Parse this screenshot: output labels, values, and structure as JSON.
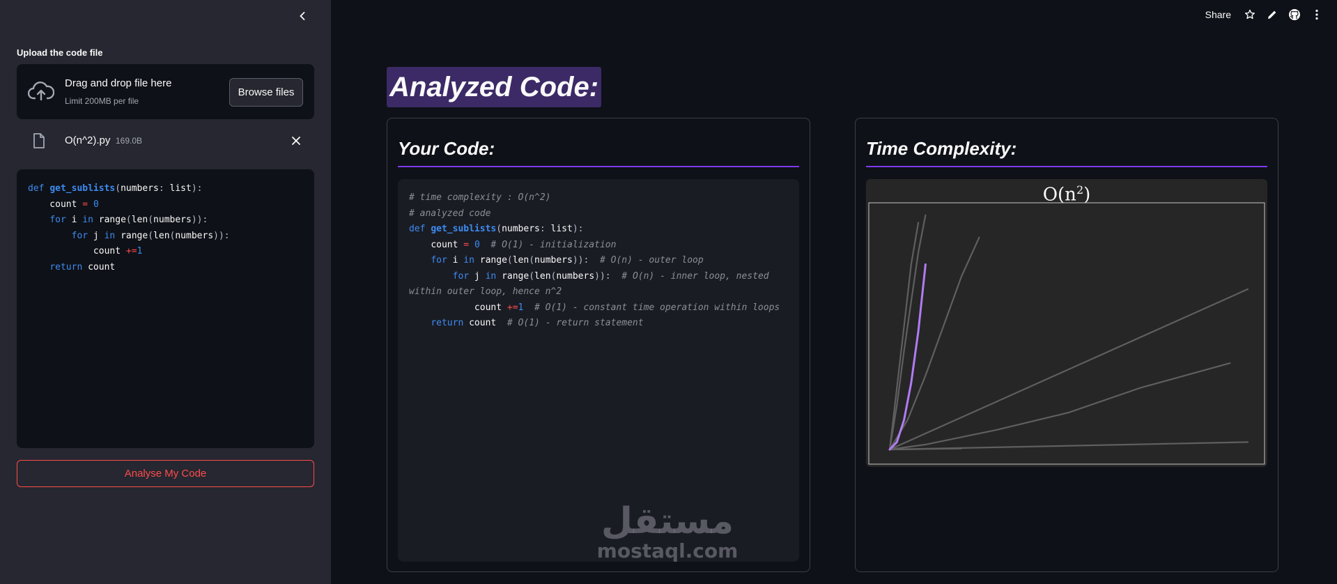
{
  "sidebar": {
    "upload_label": "Upload the code file",
    "dropzone": {
      "title": "Drag and drop file here",
      "limit": "Limit 200MB per file",
      "browse_label": "Browse files"
    },
    "file": {
      "name": "O(n^2).py",
      "size": "169.0B"
    },
    "analyse_label": "Analyse My Code"
  },
  "header": {
    "share_label": "Share"
  },
  "main": {
    "title": "Analyzed Code:",
    "code_panel": {
      "heading": "Your Code:"
    },
    "tc_panel": {
      "heading": "Time Complexity:"
    }
  },
  "watermark": {
    "arabic": "مستقل",
    "latin": "mostaql.com"
  },
  "colors": {
    "accent": "#7c3aed",
    "primary_red": "#ff4b4b",
    "keyword_blue": "#3d8bf2",
    "highlight_curve": "#b07cf2"
  },
  "chart_data": {
    "type": "line",
    "title_base": "O(n",
    "title_sup": "2",
    "title_end": ")",
    "highlighted": "O(n^2)",
    "series": [
      {
        "values_x": [
          0.0,
          0.05,
          0.1,
          0.15,
          0.2
        ],
        "values_y": [
          0.0,
          0.0005,
          0.002,
          0.003,
          0.004
        ],
        "highlight": false
      },
      {
        "values_x": [
          0.0,
          0.1,
          0.2,
          0.3,
          0.5,
          0.7,
          0.95
        ],
        "values_y": [
          0.0,
          0.02,
          0.05,
          0.08,
          0.15,
          0.25,
          0.35
        ],
        "highlight": false
      },
      {
        "values_x": [
          0.0,
          1.0
        ],
        "values_y": [
          0.0,
          0.03
        ],
        "highlight": false
      },
      {
        "values_x": [
          0.0,
          1.0
        ],
        "values_y": [
          0.0,
          0.65
        ],
        "highlight": false
      },
      {
        "values_x": [
          0.0,
          0.05,
          0.1,
          0.15,
          0.2,
          0.25
        ],
        "values_y": [
          0.0,
          0.12,
          0.3,
          0.5,
          0.7,
          0.86
        ],
        "highlight": false
      },
      {
        "values_x": [
          0.0,
          0.02,
          0.04,
          0.06,
          0.08,
          0.1
        ],
        "values_y": [
          0.0,
          0.18,
          0.4,
          0.6,
          0.8,
          0.95
        ],
        "highlight": false
      },
      {
        "values_x": [
          0.0,
          0.02,
          0.04,
          0.06,
          0.08
        ],
        "values_y": [
          0.0,
          0.25,
          0.5,
          0.75,
          0.92
        ],
        "highlight": false
      },
      {
        "values_x": [
          0.0,
          0.02,
          0.04,
          0.06,
          0.08,
          0.1
        ],
        "values_y": [
          0.0,
          0.03,
          0.12,
          0.27,
          0.48,
          0.75
        ],
        "highlight": true
      }
    ],
    "xlim": [
      0,
      1
    ],
    "ylim": [
      0,
      1
    ]
  }
}
